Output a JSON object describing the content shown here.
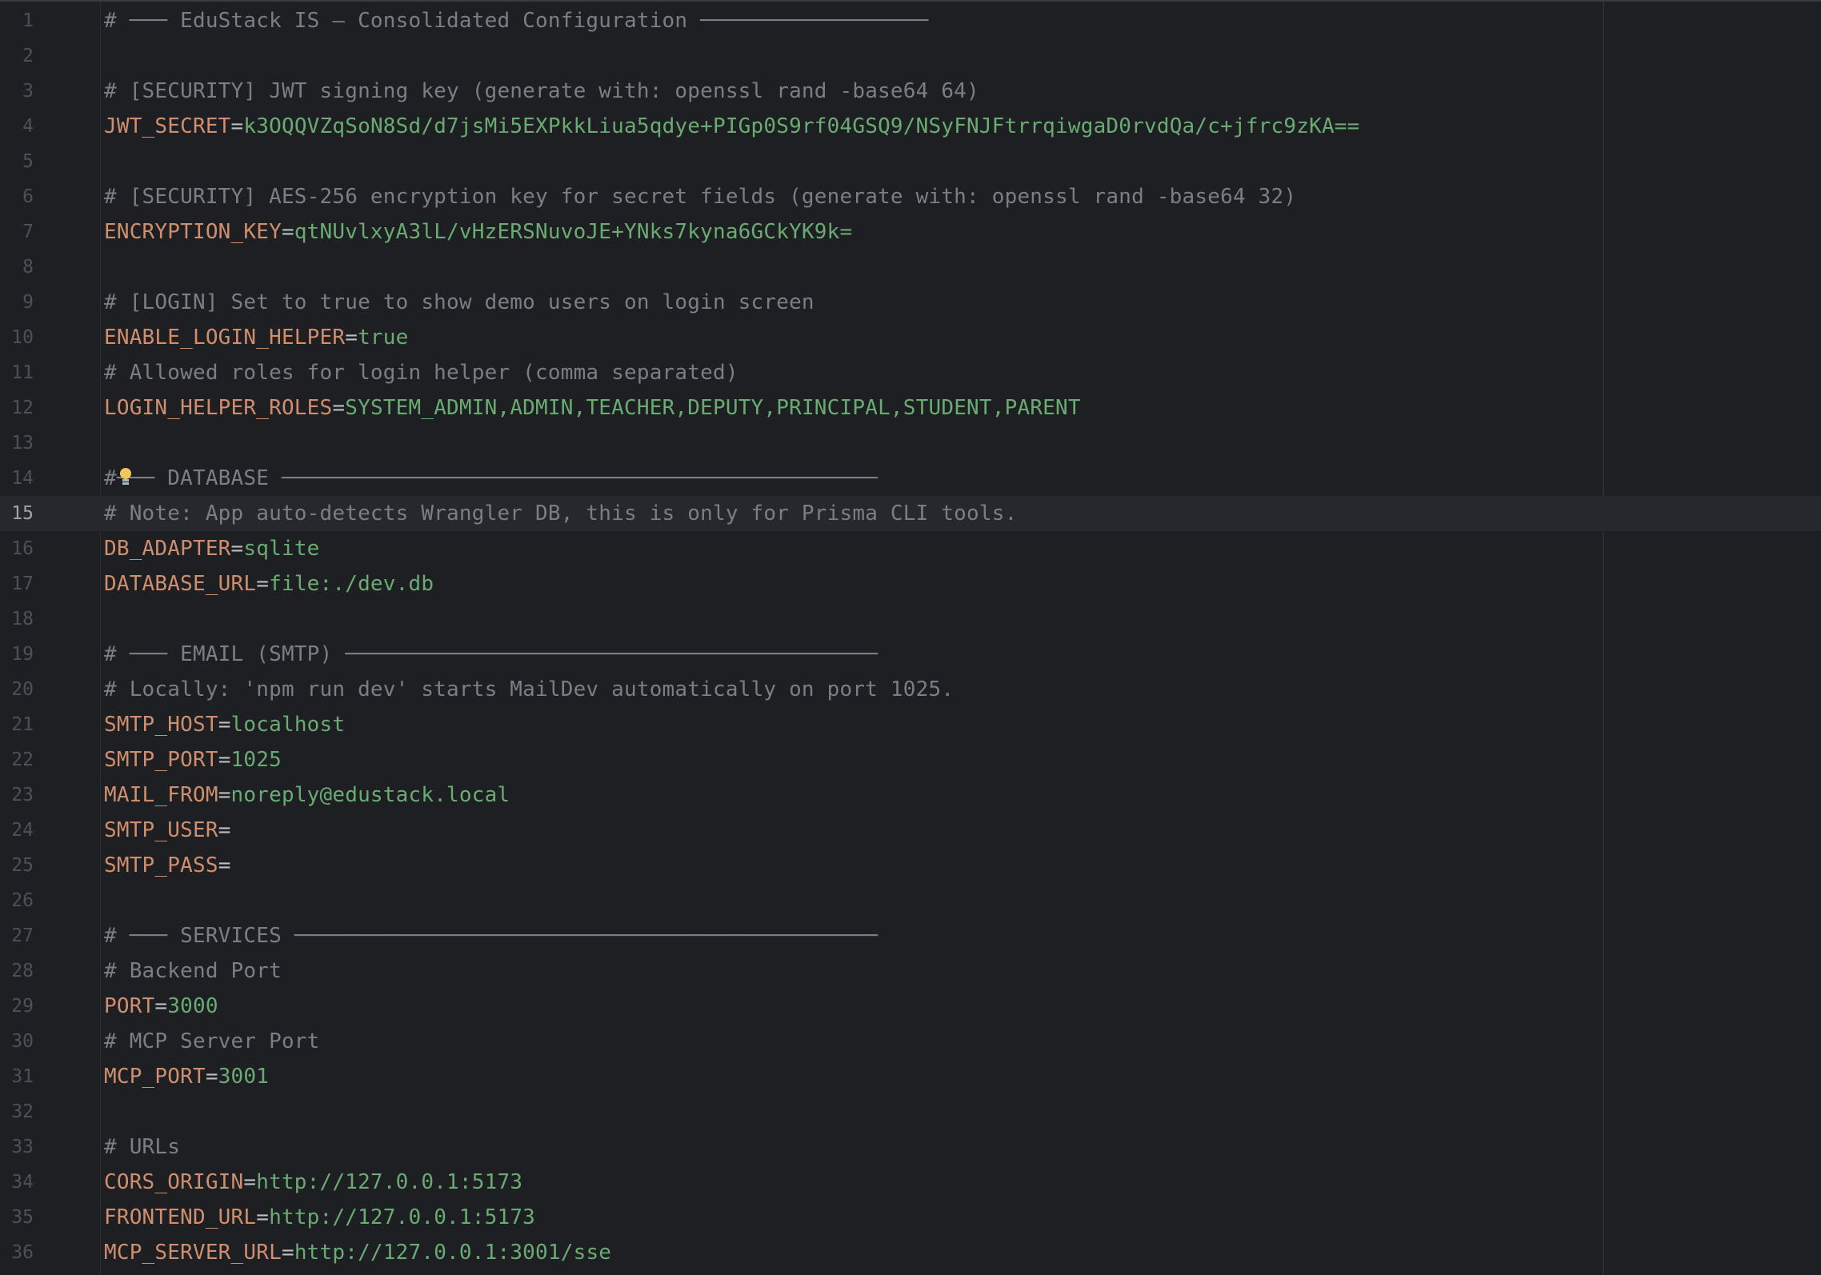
{
  "editor": {
    "current_line": 15,
    "lines": [
      {
        "num": "1",
        "type": "comment",
        "text": "# ─── EduStack IS – Consolidated Configuration ──────────────────"
      },
      {
        "num": "2",
        "type": "blank"
      },
      {
        "num": "3",
        "type": "comment",
        "text": "# [SECURITY] JWT signing key (generate with: openssl rand -base64 64)"
      },
      {
        "num": "4",
        "type": "kv",
        "key": "JWT_SECRET",
        "eq": "=",
        "value": "k3OQQVZqSoN8Sd/d7jsMi5EXPkkLiua5qdye+PIGp0S9rf04GSQ9/NSyFNJFtrrqiwgaD0rvdQa/c+jfrc9zKA=="
      },
      {
        "num": "5",
        "type": "blank"
      },
      {
        "num": "6",
        "type": "comment",
        "text": "# [SECURITY] AES-256 encryption key for secret fields (generate with: openssl rand -base64 32)"
      },
      {
        "num": "7",
        "type": "kv",
        "key": "ENCRYPTION_KEY",
        "eq": "=",
        "value": "qtNUvlxyA3lL/vHzERSNuvoJE+YNks7kyna6GCkYK9k="
      },
      {
        "num": "8",
        "type": "blank"
      },
      {
        "num": "9",
        "type": "comment",
        "text": "# [LOGIN] Set to true to show demo users on login screen"
      },
      {
        "num": "10",
        "type": "kv",
        "key": "ENABLE_LOGIN_HELPER",
        "eq": "=",
        "value": "true"
      },
      {
        "num": "11",
        "type": "comment",
        "text": "# Allowed roles for login helper (comma separated)"
      },
      {
        "num": "12",
        "type": "kv",
        "key": "LOGIN_HELPER_ROLES",
        "eq": "=",
        "value": "SYSTEM_ADMIN,ADMIN,TEACHER,DEPUTY,PRINCIPAL,STUDENT,PARENT"
      },
      {
        "num": "13",
        "type": "blank"
      },
      {
        "num": "14",
        "type": "comment",
        "text": "#─── DATABASE ───────────────────────────────────────────────"
      },
      {
        "num": "15",
        "type": "comment",
        "text": "# Note: App auto-detects Wrangler DB, this is only for Prisma CLI tools."
      },
      {
        "num": "16",
        "type": "kv",
        "key": "DB_ADAPTER",
        "eq": "=",
        "value": "sqlite"
      },
      {
        "num": "17",
        "type": "kv",
        "key": "DATABASE_URL",
        "eq": "=",
        "value": "file:./dev.db"
      },
      {
        "num": "18",
        "type": "blank"
      },
      {
        "num": "19",
        "type": "comment",
        "text": "# ─── EMAIL (SMTP) ──────────────────────────────────────────"
      },
      {
        "num": "20",
        "type": "comment",
        "text": "# Locally: 'npm run dev' starts MailDev automatically on port 1025."
      },
      {
        "num": "21",
        "type": "kv",
        "key": "SMTP_HOST",
        "eq": "=",
        "value": "localhost"
      },
      {
        "num": "22",
        "type": "kv",
        "key": "SMTP_PORT",
        "eq": "=",
        "value": "1025"
      },
      {
        "num": "23",
        "type": "kv",
        "key": "MAIL_FROM",
        "eq": "=",
        "value": "noreply@edustack.local"
      },
      {
        "num": "24",
        "type": "kv",
        "key": "SMTP_USER",
        "eq": "=",
        "value": ""
      },
      {
        "num": "25",
        "type": "kv",
        "key": "SMTP_PASS",
        "eq": "=",
        "value": ""
      },
      {
        "num": "26",
        "type": "blank"
      },
      {
        "num": "27",
        "type": "comment",
        "text": "# ─── SERVICES ──────────────────────────────────────────────"
      },
      {
        "num": "28",
        "type": "comment",
        "text": "# Backend Port"
      },
      {
        "num": "29",
        "type": "kv",
        "key": "PORT",
        "eq": "=",
        "value": "3000"
      },
      {
        "num": "30",
        "type": "comment",
        "text": "# MCP Server Port"
      },
      {
        "num": "31",
        "type": "kv",
        "key": "MCP_PORT",
        "eq": "=",
        "value": "3001"
      },
      {
        "num": "32",
        "type": "blank"
      },
      {
        "num": "33",
        "type": "comment",
        "text": "# URLs"
      },
      {
        "num": "34",
        "type": "kv",
        "key": "CORS_ORIGIN",
        "eq": "=",
        "value": "http://127.0.0.1:5173"
      },
      {
        "num": "35",
        "type": "kv",
        "key": "FRONTEND_URL",
        "eq": "=",
        "value": "http://127.0.0.1:5173"
      },
      {
        "num": "36",
        "type": "kv",
        "key": "MCP_SERVER_URL",
        "eq": "=",
        "value": "http://127.0.0.1:3001/sse"
      }
    ]
  },
  "icons": {
    "intention_bulb": "lightbulb-icon",
    "bulb_color": "#f2c55c"
  },
  "colors": {
    "background": "#1e1f22",
    "comment": "#7a7e85",
    "key": "#cf8e6d",
    "value": "#6aab73",
    "operator": "#bcbec4",
    "line_number": "#4b5059",
    "current_line_bg": "#26282e"
  }
}
